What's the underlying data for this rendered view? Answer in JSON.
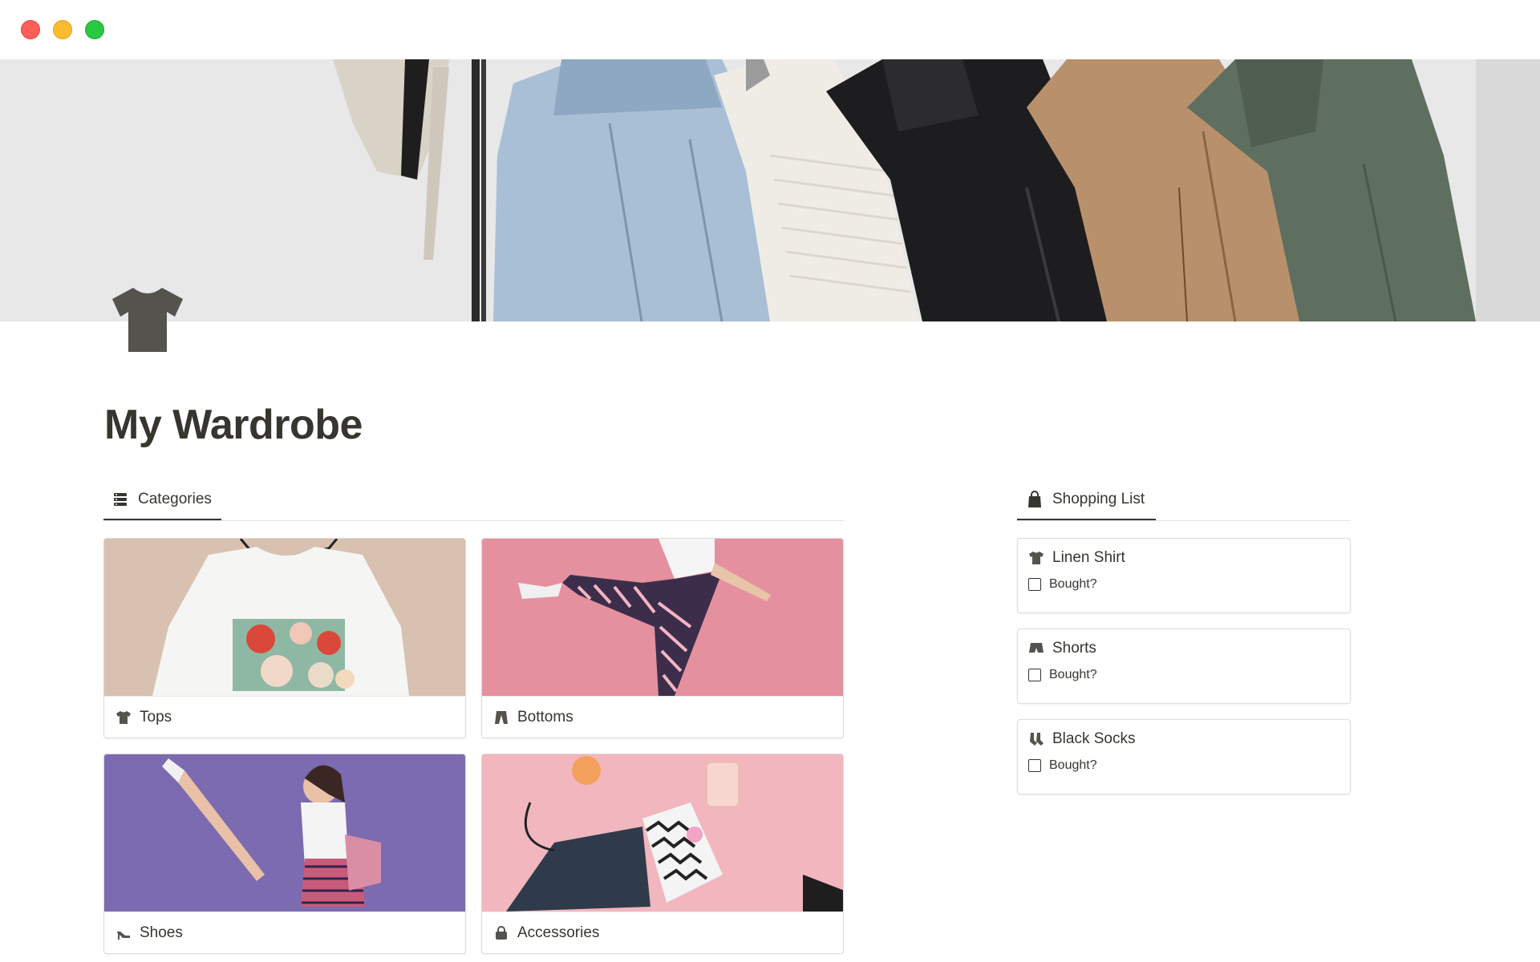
{
  "window": {
    "controls": [
      "close",
      "minimize",
      "maximize"
    ],
    "colors": {
      "close": "#ff5f57",
      "minimize": "#febc2e",
      "maximize": "#28c840"
    }
  },
  "cover": {
    "icon": "clothes-rack-cover-image"
  },
  "page": {
    "icon": "t-shirt-icon",
    "title": "My Wardrobe"
  },
  "categories": {
    "tab_label": "Categories",
    "tab_icon": "database-icon",
    "cards": [
      {
        "label": "Tops",
        "icon": "t-shirt-icon",
        "image": "white-floral-tshirt-photo"
      },
      {
        "label": "Bottoms",
        "icon": "trousers-icon",
        "image": "striped-pants-pink-photo"
      },
      {
        "label": "Shoes",
        "icon": "high-heel-icon",
        "image": "woman-purple-background-photo"
      },
      {
        "label": "Accessories",
        "icon": "handbag-icon",
        "image": "bags-pink-flatlay-photo"
      }
    ]
  },
  "shopping": {
    "tab_label": "Shopping List",
    "tab_icon": "shopping-bag-icon",
    "items": [
      {
        "name": "Linen Shirt",
        "icon": "t-shirt-icon",
        "checkbox_label": "Bought?",
        "checked": false
      },
      {
        "name": "Shorts",
        "icon": "shorts-icon",
        "checkbox_label": "Bought?",
        "checked": false
      },
      {
        "name": "Black Socks",
        "icon": "socks-icon",
        "checkbox_label": "Bought?",
        "checked": false
      }
    ]
  },
  "colors": {
    "text": "#37352f",
    "border": "#dedcd8",
    "accent_underline": "#37352f"
  }
}
